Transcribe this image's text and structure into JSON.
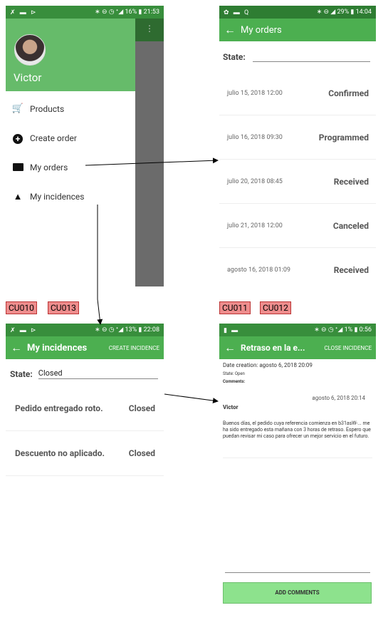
{
  "screen1": {
    "status": {
      "icons": "✗ ▬ ⊳",
      "right": "∗ ⊖ ◷ ᐩ◢ 16% ▮ 21:53"
    },
    "user": "Victor",
    "menu": [
      {
        "icon": "cart-icon",
        "glyph": "🛒",
        "label": "Products"
      },
      {
        "icon": "add-circle-icon",
        "glyph": "⊕",
        "label": "Create order"
      },
      {
        "icon": "folder-icon",
        "glyph": "▬",
        "label": "My orders"
      },
      {
        "icon": "warning-icon",
        "glyph": "▲",
        "label": "My incidences"
      }
    ]
  },
  "screen2": {
    "status": {
      "icons": "✿ ▬ Q",
      "right": "∗ ⊖ ◢ 29% ▮ 14:04"
    },
    "title": "My orders",
    "state_label": "State:",
    "orders": [
      {
        "date": "julio 15, 2018 12:00",
        "status": "Confirmed"
      },
      {
        "date": "julio 16, 2018 09:30",
        "status": "Programmed"
      },
      {
        "date": "julio 20, 2018 08:45",
        "status": "Received"
      },
      {
        "date": "julio 21, 2018 12:00",
        "status": "Canceled"
      },
      {
        "date": "agosto 16, 2018 01:09",
        "status": "Received"
      }
    ]
  },
  "labels": {
    "cu010": "CU010",
    "cu013": "CU013",
    "cu011": "CU011",
    "cu012": "CU012"
  },
  "screen3": {
    "status": {
      "icons": "✗ ▬ ⊳",
      "right": "∗ ⊖ ◷ ᐩ◢ 13% ▮ 22:08"
    },
    "title": "My incidences",
    "action": "CREATE INCIDENCE",
    "state_label": "State:",
    "state_value": "Closed",
    "items": [
      {
        "title": "Pedido entregado roto.",
        "status": "Closed"
      },
      {
        "title": "Descuento no aplicado.",
        "status": "Closed"
      }
    ]
  },
  "screen4": {
    "status": {
      "icons": "▮ ▬",
      "right": "∗ ⊖ ◷ ᐩ◢ 1% ▮ 0:56"
    },
    "title": "Retraso en la e...",
    "action": "CLOSE INCIDENCE",
    "creation": "Date creation: agosto 6, 2018 20:09",
    "state": "State: Open",
    "comments": "Comments:",
    "comment_date": "agosto 6, 2018 20:14",
    "comment_author": "Victor",
    "comment_text": "Buenos días, el pedido cuya referencia comienza en b31asW-... me ha sido entregado esta mañana con 3 horas de retraso. Espero que puedan revisar mi caso para ofrecer un mejor servicio en el futuro.",
    "button": "ADD COMMENTS"
  },
  "colors": {
    "primary": "#4caf50",
    "status_dark": "#388e3c",
    "label": "#ee8d8d",
    "button": "#8de28d"
  }
}
